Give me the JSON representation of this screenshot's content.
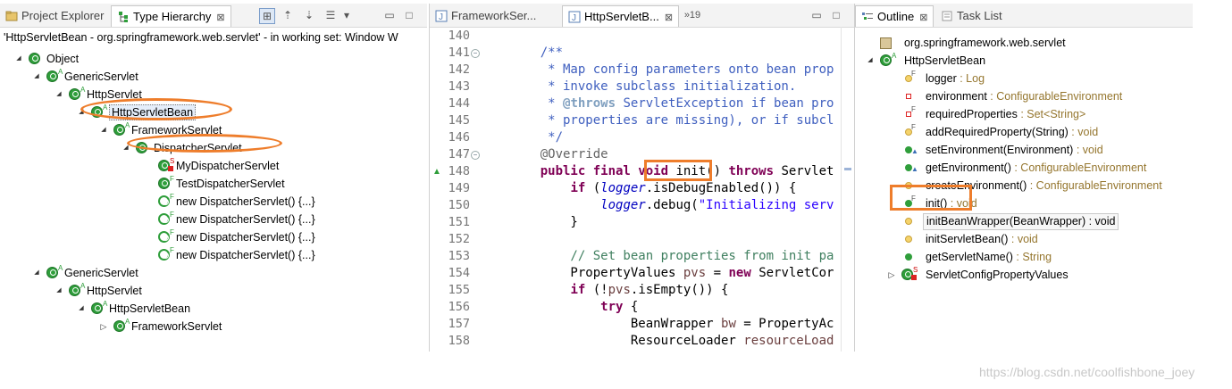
{
  "left_panel": {
    "tabs": [
      {
        "label": "Project Explorer"
      },
      {
        "label": "Type Hierarchy",
        "close": "⊠"
      }
    ],
    "status": "'HttpServletBean - org.springframework.web.servlet' - in working set: Window W",
    "tree": [
      {
        "label": "Object",
        "icon": "class-icon"
      },
      {
        "label": "GenericServlet",
        "icon": "abstract-class-icon"
      },
      {
        "label": "HttpServlet",
        "icon": "abstract-class-icon"
      },
      {
        "label": "HttpServletBean",
        "icon": "abstract-class-icon"
      },
      {
        "label": "FrameworkServlet",
        "icon": "abstract-class-icon"
      },
      {
        "label": "DispatcherServlet",
        "icon": "class-icon"
      },
      {
        "label": "MyDispatcherServlet",
        "icon": "static-class-icon"
      },
      {
        "label": "TestDispatcherServlet",
        "icon": "final-class-icon"
      },
      {
        "label": "new DispatcherServlet() {...}",
        "icon": "anon-class-icon"
      },
      {
        "label": "new DispatcherServlet() {...}",
        "icon": "anon-class-icon"
      },
      {
        "label": "new DispatcherServlet() {...}",
        "icon": "anon-class-icon"
      },
      {
        "label": "new DispatcherServlet() {...}",
        "icon": "anon-class-icon"
      },
      {
        "label": "GenericServlet",
        "icon": "abstract-class-icon"
      },
      {
        "label": "HttpServlet",
        "icon": "abstract-class-icon"
      },
      {
        "label": "HttpServletBean",
        "icon": "abstract-class-icon"
      },
      {
        "label": "FrameworkServlet",
        "icon": "abstract-class-icon"
      }
    ]
  },
  "editor": {
    "tabs": [
      {
        "label": "FrameworkSer..."
      },
      {
        "label": "HttpServletB...",
        "close": "⊠"
      },
      {
        "label": "»19"
      }
    ],
    "lines": [
      {
        "n": "140",
        "parts": [
          {
            "t": "",
            "c": ""
          }
        ]
      },
      {
        "n": "141",
        "parts": [
          {
            "t": "    /**",
            "c": "cm"
          }
        ]
      },
      {
        "n": "142",
        "parts": [
          {
            "t": "     * Map config parameters onto bean prop",
            "c": "cm"
          }
        ]
      },
      {
        "n": "143",
        "parts": [
          {
            "t": "     * invoke subclass initialization.",
            "c": "cm"
          }
        ]
      },
      {
        "n": "144",
        "parts": [
          {
            "t": "     * ",
            "c": "cm"
          },
          {
            "t": "@throws",
            "c": "jdtag"
          },
          {
            "t": " ServletException if bean pro",
            "c": "cm"
          }
        ]
      },
      {
        "n": "145",
        "parts": [
          {
            "t": "     * properties are missing), or if subcl",
            "c": "cm"
          }
        ]
      },
      {
        "n": "146",
        "parts": [
          {
            "t": "     */",
            "c": "cm"
          }
        ]
      },
      {
        "n": "147",
        "parts": [
          {
            "t": "    @Override",
            "c": "ann"
          }
        ]
      },
      {
        "n": "148",
        "parts": [
          {
            "t": "    public final void ",
            "c": "kw"
          },
          {
            "t": "init()",
            "c": ""
          },
          {
            "t": " throws ",
            "c": "kw"
          },
          {
            "t": "Servlet",
            "c": ""
          }
        ]
      },
      {
        "n": "149",
        "parts": [
          {
            "t": "        ",
            "c": ""
          },
          {
            "t": "if",
            "c": "kw"
          },
          {
            "t": " (",
            "c": ""
          },
          {
            "t": "logger",
            "c": "fld"
          },
          {
            "t": ".isDebugEnabled()) {",
            "c": ""
          }
        ]
      },
      {
        "n": "150",
        "parts": [
          {
            "t": "            ",
            "c": ""
          },
          {
            "t": "logger",
            "c": "fld"
          },
          {
            "t": ".debug(",
            "c": ""
          },
          {
            "t": "\"Initializing serv",
            "c": "str"
          }
        ]
      },
      {
        "n": "151",
        "parts": [
          {
            "t": "        }",
            "c": ""
          }
        ]
      },
      {
        "n": "152",
        "parts": [
          {
            "t": "",
            "c": ""
          }
        ]
      },
      {
        "n": "153",
        "parts": [
          {
            "t": "        // Set bean properties from init pa",
            "c": "cmline"
          }
        ]
      },
      {
        "n": "154",
        "parts": [
          {
            "t": "        PropertyValues ",
            "c": ""
          },
          {
            "t": "pvs",
            "c": "var"
          },
          {
            "t": " = ",
            "c": ""
          },
          {
            "t": "new",
            "c": "kw"
          },
          {
            "t": " ServletCor",
            "c": ""
          }
        ]
      },
      {
        "n": "155",
        "parts": [
          {
            "t": "        ",
            "c": ""
          },
          {
            "t": "if",
            "c": "kw"
          },
          {
            "t": " (!",
            "c": ""
          },
          {
            "t": "pvs",
            "c": "var"
          },
          {
            "t": ".isEmpty()) {",
            "c": ""
          }
        ]
      },
      {
        "n": "156",
        "parts": [
          {
            "t": "            ",
            "c": ""
          },
          {
            "t": "try",
            "c": "kw"
          },
          {
            "t": " {",
            "c": ""
          }
        ]
      },
      {
        "n": "157",
        "parts": [
          {
            "t": "                BeanWrapper ",
            "c": ""
          },
          {
            "t": "bw",
            "c": "var"
          },
          {
            "t": " = PropertyAc",
            "c": ""
          }
        ]
      },
      {
        "n": "158",
        "parts": [
          {
            "t": "                ResourceLoader ",
            "c": ""
          },
          {
            "t": "resourceLoad",
            "c": "var"
          }
        ]
      }
    ]
  },
  "outline": {
    "tabs": [
      {
        "label": "Outline",
        "close": "⊠"
      },
      {
        "label": "Task List"
      }
    ],
    "items": [
      {
        "name": "org.springframework.web.servlet",
        "type": ""
      },
      {
        "name": "HttpServletBean",
        "type": ""
      },
      {
        "name": "logger",
        "type": " : Log"
      },
      {
        "name": "environment",
        "type": " : ConfigurableEnvironment"
      },
      {
        "name": "requiredProperties",
        "type": " : Set<String>"
      },
      {
        "name": "addRequiredProperty(String)",
        "type": " : void"
      },
      {
        "name": "setEnvironment(Environment)",
        "type": " : void"
      },
      {
        "name": "getEnvironment()",
        "type": " : ConfigurableEnvironment"
      },
      {
        "name": "createEnvironment()",
        "type": " : ConfigurableEnvironment"
      },
      {
        "name": "init()",
        "type": " : void"
      },
      {
        "name": "initBeanWrapper(BeanWrapper) : void",
        "type": ""
      },
      {
        "name": "initServletBean()",
        "type": " : void"
      },
      {
        "name": "getServletName()",
        "type": " : String"
      },
      {
        "name": "ServletConfigPropertyValues",
        "type": ""
      }
    ]
  },
  "watermark": "https://blog.csdn.net/coolfishbone_joey",
  "colors": {
    "highlight": "#ee7d2b",
    "class_green": "#2f9e3b",
    "comment": "#3f5fbf",
    "keyword": "#7f0055"
  }
}
